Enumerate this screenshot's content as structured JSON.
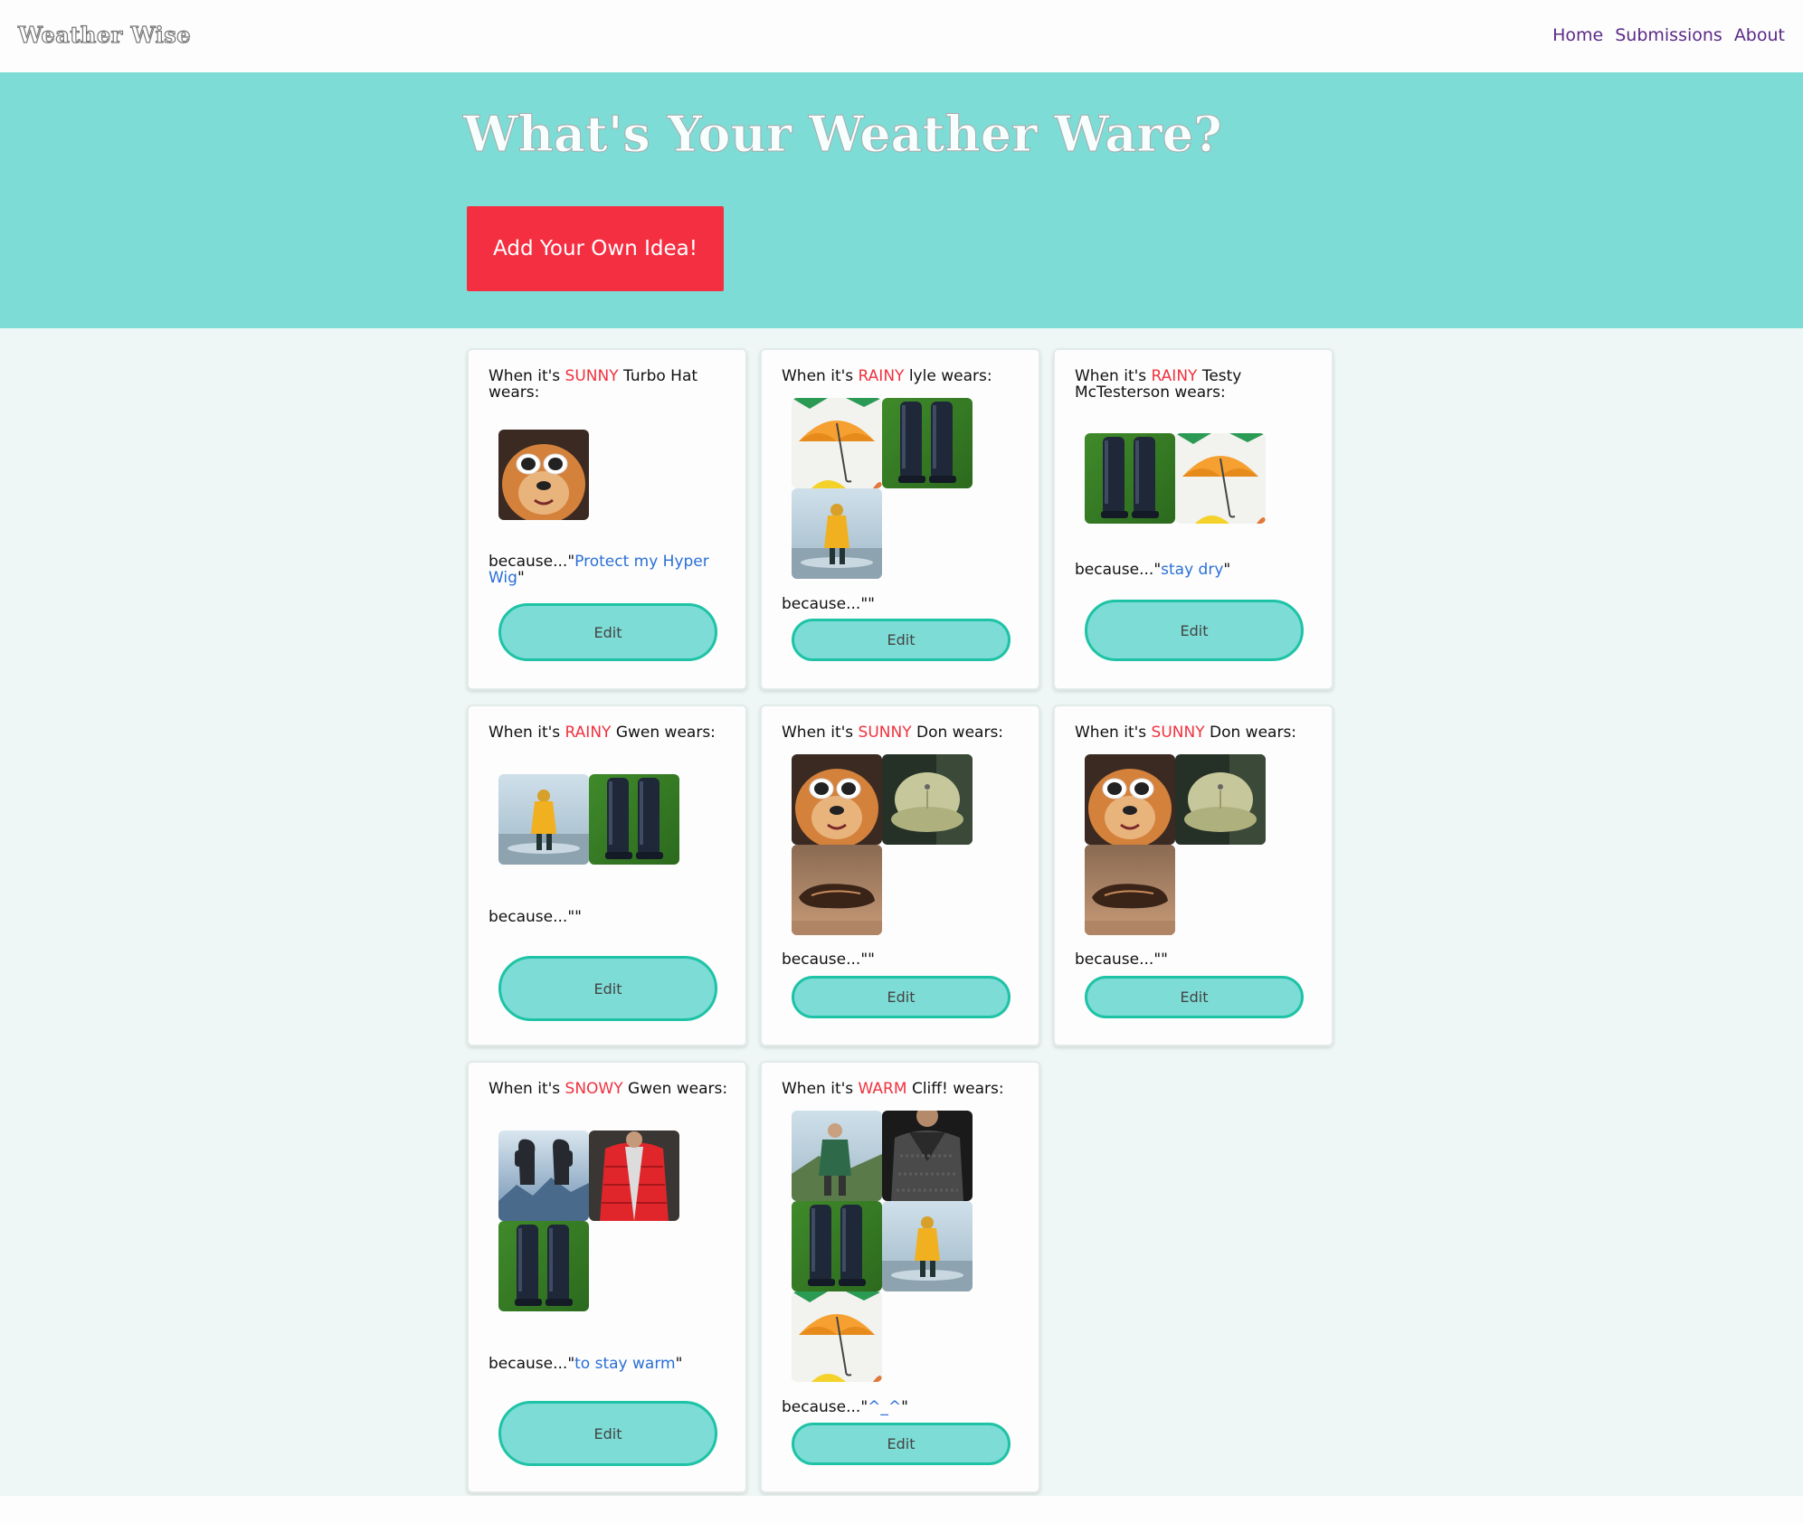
{
  "nav": {
    "brand": "Weather Wise",
    "links": [
      "Home",
      "Submissions",
      "About"
    ]
  },
  "hero": {
    "title": "What's Your Weather Ware?",
    "button_label": "Add Your Own Idea!"
  },
  "labels": {
    "prefix": "When it's ",
    "suffix": " wears:",
    "because_prefix": "because...\"",
    "because_suffix": "\"",
    "edit": "Edit"
  },
  "cards": [
    {
      "condition": "SUNNY",
      "name": "Turbo Hat",
      "reason": "Protect my Hyper Wig",
      "items": [
        "dog-sunglasses"
      ]
    },
    {
      "condition": "RAINY",
      "name": "lyle",
      "reason": "",
      "items": [
        "umbrella",
        "rain-boots",
        "yellow-raincoat"
      ]
    },
    {
      "condition": "RAINY",
      "name": "Testy McTesterson",
      "reason": "stay dry",
      "items": [
        "rain-boots",
        "umbrella"
      ]
    },
    {
      "condition": "RAINY",
      "name": "Gwen",
      "reason": "",
      "items": [
        "yellow-raincoat",
        "rain-boots"
      ]
    },
    {
      "condition": "SUNNY",
      "name": "Don",
      "reason": "",
      "items": [
        "dog-sunglasses",
        "baseball-cap",
        "loafers"
      ]
    },
    {
      "condition": "SUNNY",
      "name": "Don",
      "reason": "",
      "items": [
        "dog-sunglasses",
        "baseball-cap",
        "loafers"
      ]
    },
    {
      "condition": "SNOWY",
      "name": "Gwen",
      "reason": "to stay warm",
      "items": [
        "mittens",
        "red-puffer-jacket",
        "rain-boots"
      ]
    },
    {
      "condition": "WARM",
      "name": "Cliff!",
      "reason": "^_^",
      "items": [
        "hiking-jacket",
        "knit-sweater",
        "rain-boots",
        "yellow-raincoat",
        "umbrella"
      ]
    }
  ]
}
